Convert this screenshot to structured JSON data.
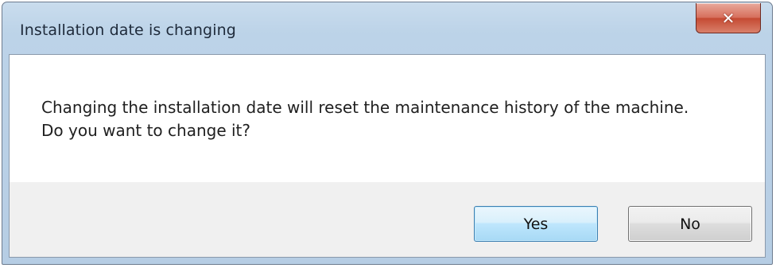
{
  "dialog": {
    "title": "Installation date is changing",
    "close_icon": "close-icon",
    "close_glyph": "✕",
    "message_line1": "Changing the installation date will reset the maintenance history of the machine.",
    "message_line2": "Do you want to change it?",
    "buttons": {
      "yes_label": "Yes",
      "no_label": "No"
    },
    "default_button": "Yes"
  },
  "colors": {
    "close_button": "#c54a33",
    "frame": "#b6cde4",
    "default_button_border": "#3c7fb1"
  }
}
